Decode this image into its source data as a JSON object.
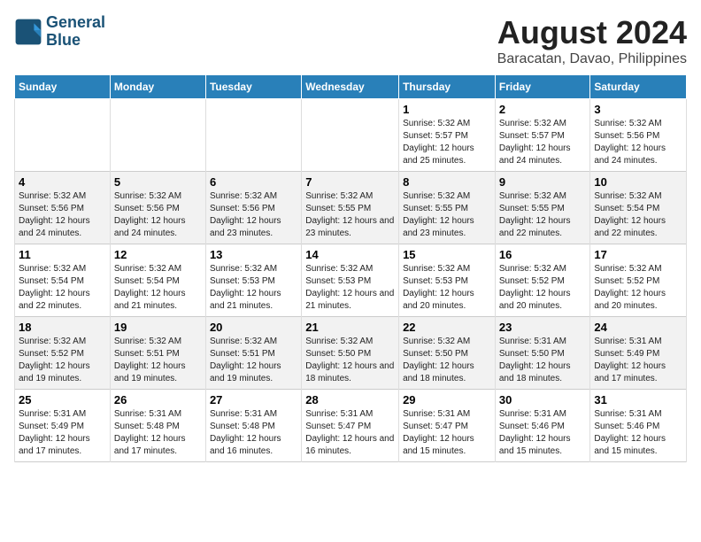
{
  "header": {
    "logo_line1": "General",
    "logo_line2": "Blue",
    "month_year": "August 2024",
    "location": "Baracatan, Davao, Philippines"
  },
  "weekdays": [
    "Sunday",
    "Monday",
    "Tuesday",
    "Wednesday",
    "Thursday",
    "Friday",
    "Saturday"
  ],
  "weeks": [
    [
      {
        "day": "",
        "sunrise": "",
        "sunset": "",
        "daylight": ""
      },
      {
        "day": "",
        "sunrise": "",
        "sunset": "",
        "daylight": ""
      },
      {
        "day": "",
        "sunrise": "",
        "sunset": "",
        "daylight": ""
      },
      {
        "day": "",
        "sunrise": "",
        "sunset": "",
        "daylight": ""
      },
      {
        "day": "1",
        "sunrise": "Sunrise: 5:32 AM",
        "sunset": "Sunset: 5:57 PM",
        "daylight": "Daylight: 12 hours and 25 minutes."
      },
      {
        "day": "2",
        "sunrise": "Sunrise: 5:32 AM",
        "sunset": "Sunset: 5:57 PM",
        "daylight": "Daylight: 12 hours and 24 minutes."
      },
      {
        "day": "3",
        "sunrise": "Sunrise: 5:32 AM",
        "sunset": "Sunset: 5:56 PM",
        "daylight": "Daylight: 12 hours and 24 minutes."
      }
    ],
    [
      {
        "day": "4",
        "sunrise": "Sunrise: 5:32 AM",
        "sunset": "Sunset: 5:56 PM",
        "daylight": "Daylight: 12 hours and 24 minutes."
      },
      {
        "day": "5",
        "sunrise": "Sunrise: 5:32 AM",
        "sunset": "Sunset: 5:56 PM",
        "daylight": "Daylight: 12 hours and 24 minutes."
      },
      {
        "day": "6",
        "sunrise": "Sunrise: 5:32 AM",
        "sunset": "Sunset: 5:56 PM",
        "daylight": "Daylight: 12 hours and 23 minutes."
      },
      {
        "day": "7",
        "sunrise": "Sunrise: 5:32 AM",
        "sunset": "Sunset: 5:55 PM",
        "daylight": "Daylight: 12 hours and 23 minutes."
      },
      {
        "day": "8",
        "sunrise": "Sunrise: 5:32 AM",
        "sunset": "Sunset: 5:55 PM",
        "daylight": "Daylight: 12 hours and 23 minutes."
      },
      {
        "day": "9",
        "sunrise": "Sunrise: 5:32 AM",
        "sunset": "Sunset: 5:55 PM",
        "daylight": "Daylight: 12 hours and 22 minutes."
      },
      {
        "day": "10",
        "sunrise": "Sunrise: 5:32 AM",
        "sunset": "Sunset: 5:54 PM",
        "daylight": "Daylight: 12 hours and 22 minutes."
      }
    ],
    [
      {
        "day": "11",
        "sunrise": "Sunrise: 5:32 AM",
        "sunset": "Sunset: 5:54 PM",
        "daylight": "Daylight: 12 hours and 22 minutes."
      },
      {
        "day": "12",
        "sunrise": "Sunrise: 5:32 AM",
        "sunset": "Sunset: 5:54 PM",
        "daylight": "Daylight: 12 hours and 21 minutes."
      },
      {
        "day": "13",
        "sunrise": "Sunrise: 5:32 AM",
        "sunset": "Sunset: 5:53 PM",
        "daylight": "Daylight: 12 hours and 21 minutes."
      },
      {
        "day": "14",
        "sunrise": "Sunrise: 5:32 AM",
        "sunset": "Sunset: 5:53 PM",
        "daylight": "Daylight: 12 hours and 21 minutes."
      },
      {
        "day": "15",
        "sunrise": "Sunrise: 5:32 AM",
        "sunset": "Sunset: 5:53 PM",
        "daylight": "Daylight: 12 hours and 20 minutes."
      },
      {
        "day": "16",
        "sunrise": "Sunrise: 5:32 AM",
        "sunset": "Sunset: 5:52 PM",
        "daylight": "Daylight: 12 hours and 20 minutes."
      },
      {
        "day": "17",
        "sunrise": "Sunrise: 5:32 AM",
        "sunset": "Sunset: 5:52 PM",
        "daylight": "Daylight: 12 hours and 20 minutes."
      }
    ],
    [
      {
        "day": "18",
        "sunrise": "Sunrise: 5:32 AM",
        "sunset": "Sunset: 5:52 PM",
        "daylight": "Daylight: 12 hours and 19 minutes."
      },
      {
        "day": "19",
        "sunrise": "Sunrise: 5:32 AM",
        "sunset": "Sunset: 5:51 PM",
        "daylight": "Daylight: 12 hours and 19 minutes."
      },
      {
        "day": "20",
        "sunrise": "Sunrise: 5:32 AM",
        "sunset": "Sunset: 5:51 PM",
        "daylight": "Daylight: 12 hours and 19 minutes."
      },
      {
        "day": "21",
        "sunrise": "Sunrise: 5:32 AM",
        "sunset": "Sunset: 5:50 PM",
        "daylight": "Daylight: 12 hours and 18 minutes."
      },
      {
        "day": "22",
        "sunrise": "Sunrise: 5:32 AM",
        "sunset": "Sunset: 5:50 PM",
        "daylight": "Daylight: 12 hours and 18 minutes."
      },
      {
        "day": "23",
        "sunrise": "Sunrise: 5:31 AM",
        "sunset": "Sunset: 5:50 PM",
        "daylight": "Daylight: 12 hours and 18 minutes."
      },
      {
        "day": "24",
        "sunrise": "Sunrise: 5:31 AM",
        "sunset": "Sunset: 5:49 PM",
        "daylight": "Daylight: 12 hours and 17 minutes."
      }
    ],
    [
      {
        "day": "25",
        "sunrise": "Sunrise: 5:31 AM",
        "sunset": "Sunset: 5:49 PM",
        "daylight": "Daylight: 12 hours and 17 minutes."
      },
      {
        "day": "26",
        "sunrise": "Sunrise: 5:31 AM",
        "sunset": "Sunset: 5:48 PM",
        "daylight": "Daylight: 12 hours and 17 minutes."
      },
      {
        "day": "27",
        "sunrise": "Sunrise: 5:31 AM",
        "sunset": "Sunset: 5:48 PM",
        "daylight": "Daylight: 12 hours and 16 minutes."
      },
      {
        "day": "28",
        "sunrise": "Sunrise: 5:31 AM",
        "sunset": "Sunset: 5:47 PM",
        "daylight": "Daylight: 12 hours and 16 minutes."
      },
      {
        "day": "29",
        "sunrise": "Sunrise: 5:31 AM",
        "sunset": "Sunset: 5:47 PM",
        "daylight": "Daylight: 12 hours and 15 minutes."
      },
      {
        "day": "30",
        "sunrise": "Sunrise: 5:31 AM",
        "sunset": "Sunset: 5:46 PM",
        "daylight": "Daylight: 12 hours and 15 minutes."
      },
      {
        "day": "31",
        "sunrise": "Sunrise: 5:31 AM",
        "sunset": "Sunset: 5:46 PM",
        "daylight": "Daylight: 12 hours and 15 minutes."
      }
    ]
  ]
}
